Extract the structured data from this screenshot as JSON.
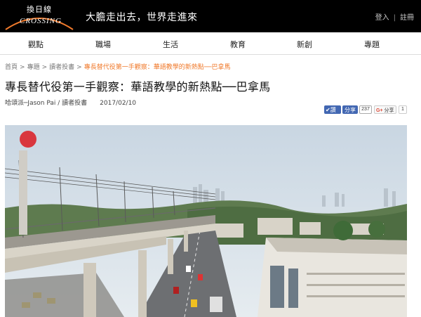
{
  "header": {
    "logo_cn": "換日線",
    "logo_en": "CROSSING",
    "slogan": "大膽走出去，世界走進來",
    "login": "登入",
    "register": "註冊"
  },
  "nav": {
    "items": [
      "觀點",
      "職場",
      "生活",
      "教育",
      "新創",
      "專題"
    ]
  },
  "breadcrumb": {
    "home": "首頁",
    "topics": "專題",
    "reader": "讀者投書",
    "current": "專長替代役第一手觀察：華語教學的新熱點──巴拿馬",
    "separator": ">"
  },
  "article": {
    "title": "專長替代役第一手觀察：華語教學的新熱點──巴拿馬",
    "author": "哈頌派─Jason Pai / 讀者投書",
    "date": "2017/02/10"
  },
  "share": {
    "fb_like": "讚",
    "fb_share": "分享",
    "fb_count": "237",
    "gplus": "分享",
    "gplus_count": "1"
  },
  "colors": {
    "header_bg": "#000000",
    "accent": "#f07a2c",
    "fb_blue": "#4267b2"
  }
}
